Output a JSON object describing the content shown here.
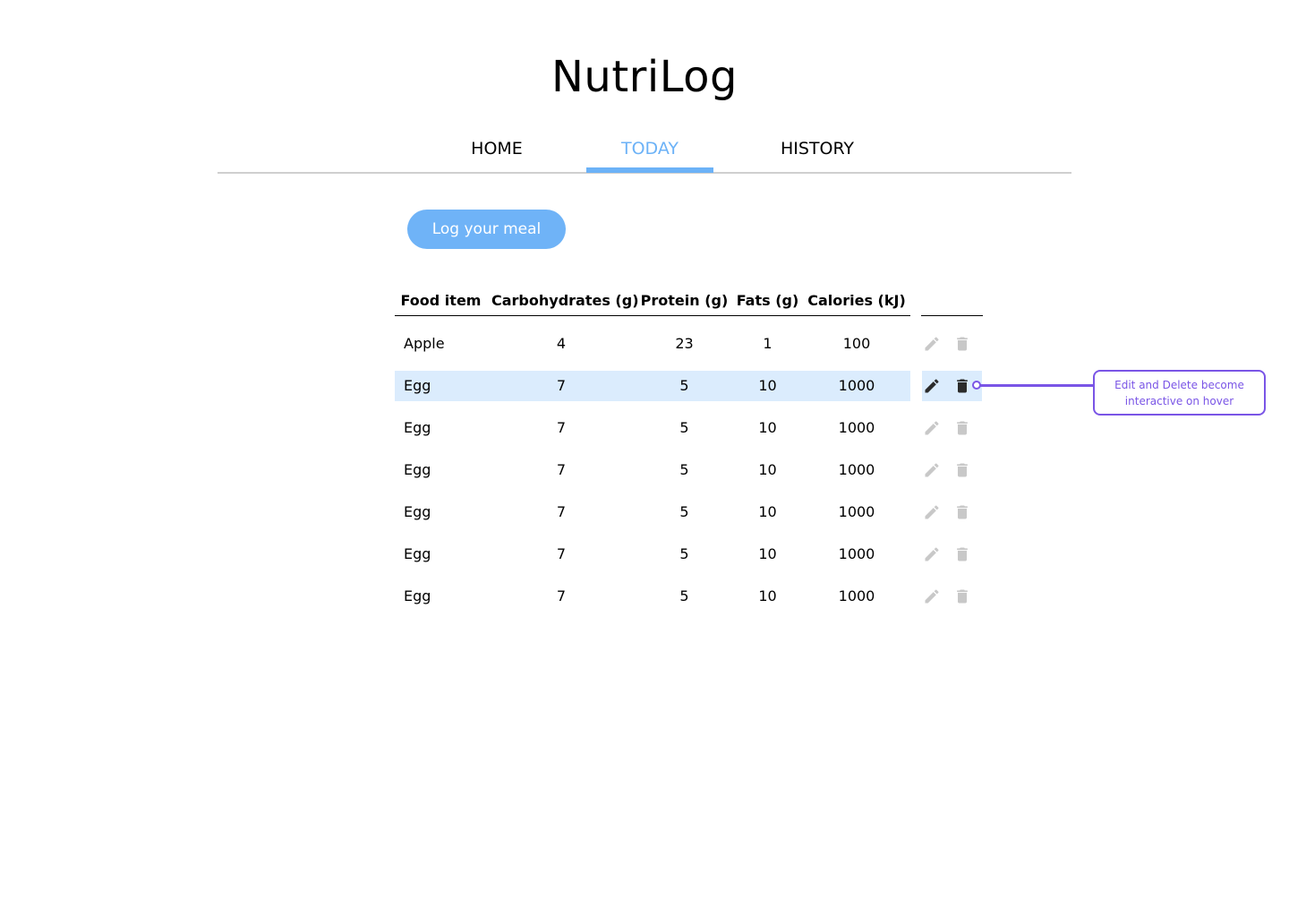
{
  "app": {
    "title": "NutriLog"
  },
  "nav": {
    "tabs": [
      {
        "label": "HOME",
        "active": false
      },
      {
        "label": "TODAY",
        "active": true
      },
      {
        "label": "HISTORY",
        "active": false
      }
    ]
  },
  "actions": {
    "log_meal_label": "Log your meal"
  },
  "table": {
    "columns": [
      "Food item",
      "Carbohydrates (g)",
      "Protein (g)",
      "Fats (g)",
      "Calories (kJ)"
    ],
    "rows": [
      [
        "Apple",
        "4",
        "23",
        "1",
        "100"
      ],
      [
        "Egg",
        "7",
        "5",
        "10",
        "1000"
      ],
      [
        "Egg",
        "7",
        "5",
        "10",
        "1000"
      ],
      [
        "Egg",
        "7",
        "5",
        "10",
        "1000"
      ],
      [
        "Egg",
        "7",
        "5",
        "10",
        "1000"
      ],
      [
        "Egg",
        "7",
        "5",
        "10",
        "1000"
      ],
      [
        "Egg",
        "7",
        "5",
        "10",
        "1000"
      ]
    ],
    "hovered_row_index": 1,
    "row_icons": [
      "pencil-icon",
      "trash-icon"
    ]
  },
  "annotation": {
    "text": "Edit and Delete become interactive on hover"
  },
  "colors": {
    "accent": "#6cb2f7",
    "button": "#6fb3f7",
    "hover_row": "#dbecfd",
    "icon_inactive": "#c8c8c8",
    "icon_active": "#2b2b2b",
    "annotation": "#7a55e6"
  }
}
